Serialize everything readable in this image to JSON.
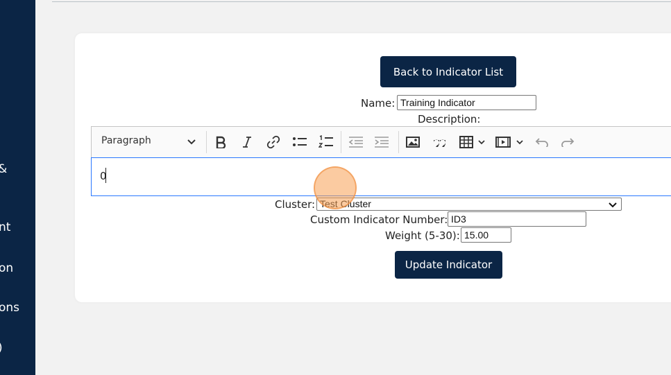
{
  "sidebar": {
    "fragments": [
      "&",
      "nt",
      "on",
      "ons",
      ")"
    ]
  },
  "card": {
    "back_button_label": "Back to Indicator List",
    "name_label": "Name:",
    "name_value": "Training Indicator",
    "description_label": "Description:",
    "editor": {
      "paragraph_label": "Paragraph",
      "content": "0",
      "icons": [
        "chevron-down-icon",
        "bold-icon",
        "italic-icon",
        "link-icon",
        "bulleted-list-icon",
        "numbered-list-icon",
        "outdent-icon",
        "indent-icon",
        "image-icon",
        "blockquote-icon",
        "table-icon",
        "media-icon",
        "undo-icon",
        "redo-icon"
      ]
    },
    "cluster_label": "Cluster:",
    "cluster_value": "Test Cluster",
    "custom_number_label": "Custom Indicator Number:",
    "custom_number_value": "ID3",
    "weight_label": "Weight (5-30):",
    "weight_value": "15.00",
    "update_button_label": "Update Indicator"
  },
  "colors": {
    "sidebar_bg": "#0b2545",
    "button_bg": "#0b2545",
    "editor_focus_border": "#2977ff",
    "click_indicator": "#f7a054"
  }
}
